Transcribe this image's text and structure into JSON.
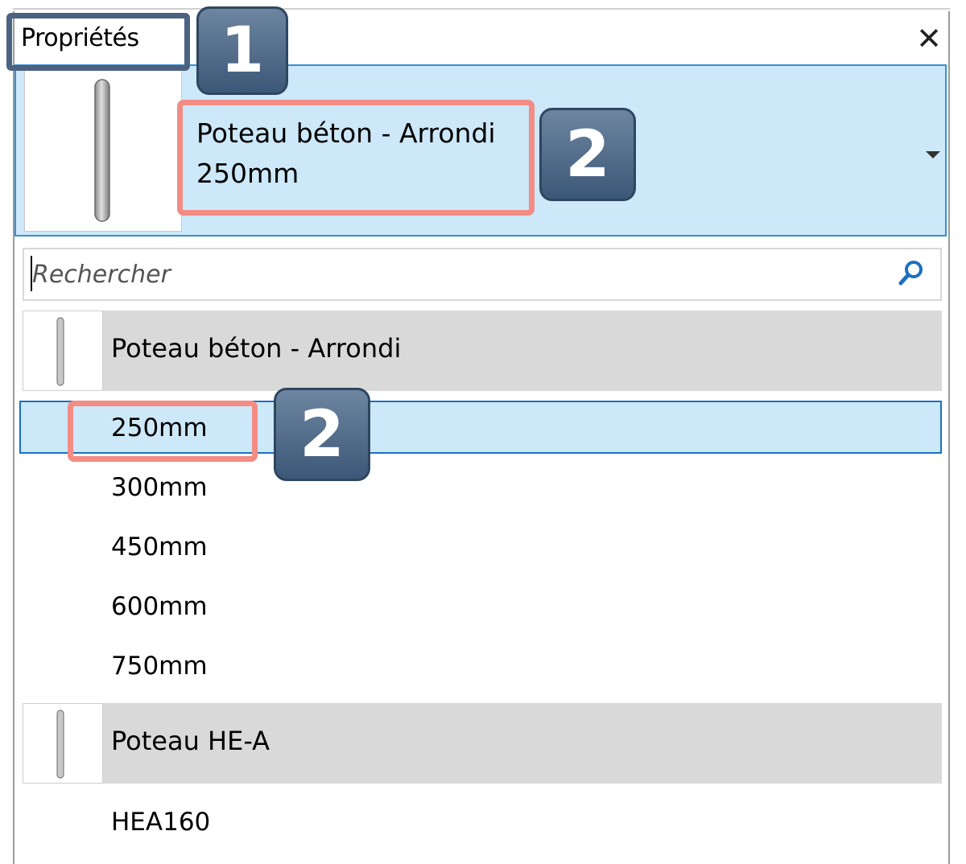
{
  "panel": {
    "title": "Propriétés",
    "close_icon": "close-icon"
  },
  "type_selector": {
    "family": "Poteau béton - Arrondi",
    "type": "250mm",
    "dropdown_icon": "chevron-down-icon"
  },
  "search": {
    "placeholder": "Rechercher",
    "value": "",
    "icon": "search-icon"
  },
  "families": [
    {
      "name": "Poteau béton - Arrondi",
      "types": [
        "250mm",
        "300mm",
        "450mm",
        "600mm",
        "750mm"
      ],
      "selected": "250mm"
    },
    {
      "name": "Poteau HE-A",
      "types": [
        "HEA160"
      ]
    }
  ],
  "callouts": {
    "one": "1",
    "two_a": "2",
    "two_b": "2"
  },
  "colors": {
    "selection_bg": "#cde8f8",
    "selection_border": "#1e6fbf",
    "callout_outline": "#f28c85",
    "callout_badge": "#4b6280"
  }
}
